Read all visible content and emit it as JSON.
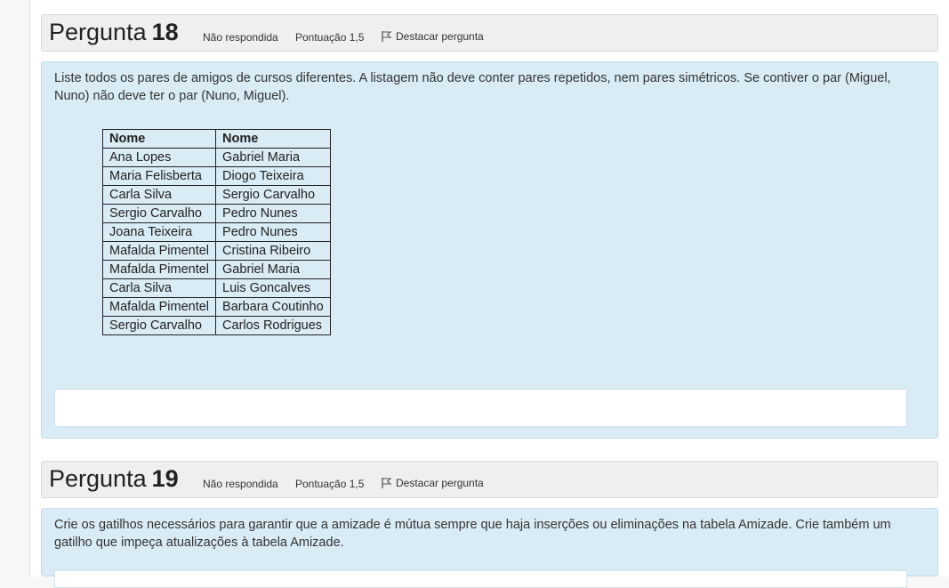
{
  "questions": [
    {
      "label": "Pergunta",
      "number": "18",
      "status": "Não respondida",
      "score": "Pontuação 1,5",
      "flag_label": "Destacar pergunta",
      "text": "Liste todos os pares de amigos de cursos diferentes. A listagem não deve conter pares repetidos, nem pares simétricos. Se contiver o par (Miguel, Nuno) não deve ter o par (Nuno, Miguel).",
      "table": {
        "headers": [
          "Nome",
          "Nome"
        ],
        "rows": [
          [
            "Ana Lopes",
            "Gabriel Maria"
          ],
          [
            "Maria Felisberta",
            "Diogo Teixeira"
          ],
          [
            "Carla Silva",
            "Sergio Carvalho"
          ],
          [
            "Sergio Carvalho",
            "Pedro Nunes"
          ],
          [
            "Joana Teixeira",
            "Pedro Nunes"
          ],
          [
            "Mafalda Pimentel",
            "Cristina Ribeiro"
          ],
          [
            "Mafalda Pimentel",
            "Gabriel Maria"
          ],
          [
            "Carla Silva",
            "Luis Goncalves"
          ],
          [
            "Mafalda Pimentel",
            "Barbara Coutinho"
          ],
          [
            "Sergio Carvalho",
            "Carlos Rodrigues"
          ]
        ]
      }
    },
    {
      "label": "Pergunta",
      "number": "19",
      "status": "Não respondida",
      "score": "Pontuação 1,5",
      "flag_label": "Destacar pergunta",
      "text": "Crie os gatilhos necessários para garantir que a amizade é mútua sempre que haja inserções ou eliminações na tabela Amizade. Crie também um gatilho que impeça atualizações à tabela Amizade."
    }
  ],
  "icons": {
    "flag": "flag-icon"
  },
  "colors": {
    "header_bg": "#efefef",
    "body_bg": "#d9ebf5",
    "answer_bg": "#ffffff"
  }
}
